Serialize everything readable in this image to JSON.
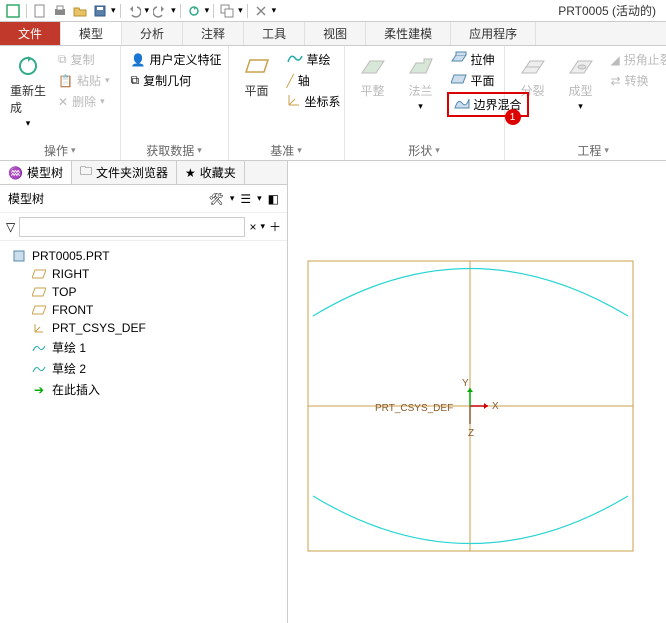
{
  "titlebar": {
    "title": "PRT0005 (活动的)"
  },
  "tabs": {
    "file": "文件",
    "items": [
      "模型",
      "分析",
      "注释",
      "工具",
      "视图",
      "柔性建模",
      "应用程序"
    ],
    "active": 0
  },
  "ribbon": {
    "ops": {
      "regen": "重新生成",
      "copy": "复制",
      "paste": "粘贴",
      "delete": "删除",
      "label": "操作"
    },
    "getdata": {
      "udf": "用户定义特征",
      "copygeom": "复制几何",
      "label": "获取数据"
    },
    "datum": {
      "plane": "平面",
      "sketch": "草绘",
      "axis": "轴",
      "csys": "坐标系",
      "label": "基准"
    },
    "shape": {
      "flat": "平整",
      "flange": "法兰",
      "extrude": "拉伸",
      "plane2": "平面",
      "boundary": "边界混合",
      "label": "形状",
      "badge": "1"
    },
    "eng": {
      "split": "分裂",
      "form": "成型",
      "corner": "拐角止裂",
      "convert": "转换",
      "label": "工程"
    }
  },
  "sidebar": {
    "tabs": {
      "tree": "模型树",
      "folders": "文件夹浏览器",
      "fav": "收藏夹"
    },
    "title": "模型树",
    "filter_clear": "×",
    "root": "PRT0005.PRT",
    "nodes": [
      {
        "icon": "datum",
        "label": "RIGHT"
      },
      {
        "icon": "datum",
        "label": "TOP"
      },
      {
        "icon": "datum",
        "label": "FRONT"
      },
      {
        "icon": "csys",
        "label": "PRT_CSYS_DEF"
      },
      {
        "icon": "sketch",
        "label": "草绘 1"
      },
      {
        "icon": "sketch",
        "label": "草绘 2"
      },
      {
        "icon": "arrow",
        "label": "在此插入"
      }
    ]
  },
  "viewport": {
    "csys_label": "PRT_CSYS_DEF",
    "ax_x": "X",
    "ax_y": "Y",
    "ax_z": "Z"
  }
}
